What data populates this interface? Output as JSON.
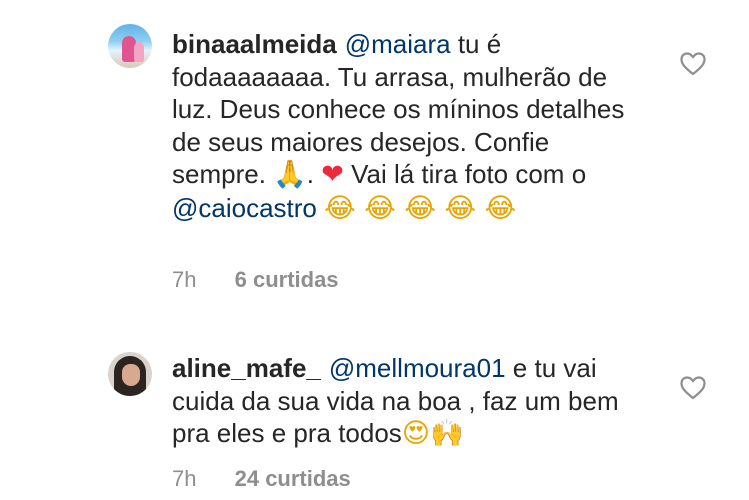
{
  "comments": [
    {
      "username": "binaaalmeida",
      "parts": {
        "m1": "@maiara",
        "t1": " tu é fodaaaaaaaa. Tu arrasa, mulherão de luz. Deus conhece os míninos detalhes de seus maiores desejos. Confie sempre. ",
        "e1": "🙏",
        "t2": ". ",
        "e2": "❤",
        "t3": " Vai lá tira foto com o ",
        "m2": "@caiocastro",
        "t4": " ",
        "e3": "😂 😂 😂 😂 😂"
      },
      "time": "7h",
      "likes": "6 curtidas"
    },
    {
      "username": "aline_mafe_",
      "parts": {
        "m1": "@mellmoura01",
        "t1": " e tu vai cuida da sua vida na boa , faz um bem pra eles e pra todos",
        "e1": "😍",
        "e2": "🙌"
      },
      "time": "7h",
      "likes": "24 curtidas"
    }
  ],
  "icons": {
    "avatar_1": "beach-photo-avatar",
    "avatar_2": "woman-portrait-avatar",
    "like": "heart-outline-icon"
  },
  "colors": {
    "text": "#262626",
    "mention": "#00376b",
    "meta": "#8e8e8e"
  }
}
